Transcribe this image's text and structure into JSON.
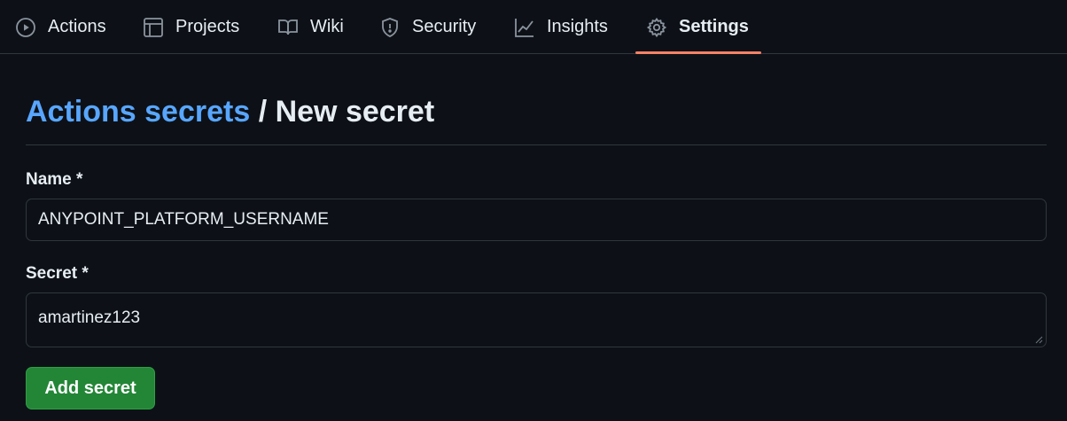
{
  "nav": {
    "tabs": [
      {
        "label": "Actions",
        "icon": "play-icon"
      },
      {
        "label": "Projects",
        "icon": "table-icon"
      },
      {
        "label": "Wiki",
        "icon": "book-icon"
      },
      {
        "label": "Security",
        "icon": "shield-icon"
      },
      {
        "label": "Insights",
        "icon": "graph-icon"
      },
      {
        "label": "Settings",
        "icon": "gear-icon",
        "active": true
      }
    ],
    "active_color": "#f78166"
  },
  "page": {
    "breadcrumb_link": "Actions secrets",
    "breadcrumb_sep": "/",
    "breadcrumb_current": "New secret"
  },
  "form": {
    "name_label": "Name *",
    "name_value": "ANYPOINT_PLATFORM_USERNAME",
    "secret_label": "Secret *",
    "secret_value": "amartinez123",
    "submit_label": "Add secret"
  },
  "colors": {
    "background": "#0d1117",
    "link": "#58a6ff",
    "button": "#238636",
    "border": "#30363d"
  }
}
